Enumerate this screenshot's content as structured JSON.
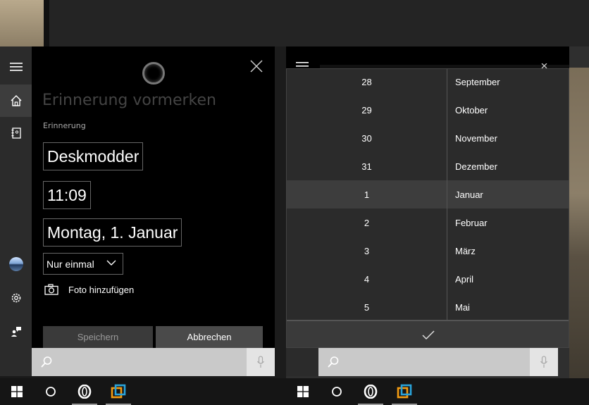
{
  "reminder": {
    "faded_title": "Erinnerung vormerken",
    "section_label": "Erinnerung",
    "title_value": "Deskmodder",
    "time_value": "11:09",
    "date_value": "Montag, 1. Januar",
    "repeat_value": "Nur einmal",
    "add_photo_label": "Foto hinzufügen",
    "save_label": "Speichern",
    "cancel_label": "Abbrechen"
  },
  "picker": {
    "days": [
      "28",
      "29",
      "30",
      "31",
      "1",
      "2",
      "3",
      "4",
      "5"
    ],
    "months": [
      "September",
      "Oktober",
      "November",
      "Dezember",
      "Januar",
      "Februar",
      "März",
      "April",
      "Mai"
    ],
    "selected_index": 4
  },
  "colors": {
    "panel_bg": "#000000",
    "sidebar_bg": "#2b2b2b",
    "picker_bg": "#2b2b2b",
    "selected_row": "#3d3d3d",
    "searchbar": "#c9c9c9",
    "taskbar": "#151515"
  },
  "icons": {
    "sidebar": [
      "hamburger-icon",
      "home-icon",
      "notebook-icon",
      "avatar",
      "gear-icon",
      "feedback-icon"
    ],
    "taskbar": [
      "windows-start-icon",
      "cortana-circle-icon",
      "opera-icon",
      "vmware-icon"
    ]
  }
}
